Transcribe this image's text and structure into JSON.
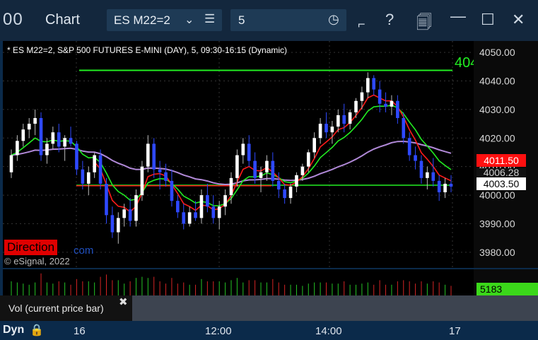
{
  "window": {
    "logo": "00",
    "title": "Chart"
  },
  "toolbar": {
    "symbol": "ES M22=2",
    "interval": "5",
    "icons": [
      "chevron-down-icon",
      "hamburger-menu-icon",
      "clock-icon",
      "draw-icon",
      "help-icon",
      "template-icon",
      "minimize-icon",
      "maximize-icon",
      "close-icon"
    ]
  },
  "chart": {
    "header": "* ES M22=2, S&P 500 FUTURES E-MINI (DAY), 5, 09:30-16:15 (Dynamic)",
    "direction_label": "Direction",
    "com_label": "com",
    "copyright": "© eSignal, 2022",
    "alert_label": "404",
    "price_red": "4011.50",
    "price_purple": "4006.28",
    "price_last": "4003.50",
    "volume_last": "5183",
    "volume_tooltip": "Vol (current price bar)",
    "dyn_label": "Dyn",
    "colors": {
      "up": "#ffffff",
      "down": "#2e49ff",
      "red": "#ff1a1a",
      "green": "#22ee22",
      "purple": "#b189d8",
      "vol_up": "#25c425",
      "vol_down": "#d42424"
    }
  },
  "chart_data": {
    "type": "candlestick",
    "y_ticks": [
      "4050.00",
      "4040.00",
      "4030.00",
      "4020.00",
      "4010.00",
      "4000.00",
      "3990.00",
      "3980.00"
    ],
    "ylim": [
      3977,
      4052
    ],
    "x_ticks": [
      "16",
      "12:00",
      "14:00",
      "17"
    ],
    "candles": [
      [
        4008,
        4016,
        4006,
        4014
      ],
      [
        4014,
        4021,
        4012,
        4019
      ],
      [
        4019,
        4025,
        4017,
        4023
      ],
      [
        4023,
        4027,
        4020,
        4025
      ],
      [
        4025,
        4030,
        4021,
        4027
      ],
      [
        4027,
        4029,
        4012,
        4014
      ],
      [
        4014,
        4020,
        4011,
        4018
      ],
      [
        4018,
        4024,
        4016,
        4022
      ],
      [
        4022,
        4025,
        4015,
        4017
      ],
      [
        4017,
        4021,
        4012,
        4020
      ],
      [
        4020,
        4024,
        4017,
        4018
      ],
      [
        4018,
        4019,
        4007,
        4009
      ],
      [
        4009,
        4012,
        4002,
        4004
      ],
      [
        4004,
        4010,
        4000,
        4008
      ],
      [
        4008,
        4015,
        4006,
        4014
      ],
      [
        4014,
        4016,
        4002,
        4004
      ],
      [
        4004,
        4006,
        3990,
        3993
      ],
      [
        3993,
        3996,
        3985,
        3987
      ],
      [
        3987,
        3994,
        3983,
        3992
      ],
      [
        3992,
        3997,
        3989,
        3995
      ],
      [
        3995,
        3999,
        3989,
        3991
      ],
      [
        3991,
        4002,
        3989,
        4000
      ],
      [
        4000,
        4012,
        3998,
        4010
      ],
      [
        4010,
        4021,
        4008,
        4018
      ],
      [
        4018,
        4020,
        4006,
        4009
      ],
      [
        4009,
        4012,
        4002,
        4008
      ],
      [
        4008,
        4011,
        4003,
        4005
      ],
      [
        4005,
        4009,
        3996,
        3998
      ],
      [
        3998,
        4000,
        3992,
        3994
      ],
      [
        3994,
        3997,
        3988,
        3990
      ],
      [
        3990,
        3996,
        3989,
        3994
      ],
      [
        3994,
        3998,
        3991,
        3992
      ],
      [
        3992,
        4002,
        3990,
        4000
      ],
      [
        4000,
        4004,
        3994,
        3996
      ],
      [
        3996,
        4000,
        3990,
        3992
      ],
      [
        3992,
        3998,
        3988,
        3996
      ],
      [
        3996,
        4002,
        3993,
        4000
      ],
      [
        4000,
        4008,
        3997,
        4006
      ],
      [
        4006,
        4016,
        4003,
        4014
      ],
      [
        4014,
        4020,
        4011,
        4018
      ],
      [
        4018,
        4021,
        4010,
        4012
      ],
      [
        4012,
        4015,
        4004,
        4006
      ],
      [
        4006,
        4010,
        4001,
        4008
      ],
      [
        4008,
        4014,
        4005,
        4012
      ],
      [
        4012,
        4015,
        4003,
        4005
      ],
      [
        4005,
        4008,
        3999,
        4002
      ],
      [
        4002,
        4004,
        3997,
        3999
      ],
      [
        3999,
        4004,
        3997,
        4003
      ],
      [
        4003,
        4008,
        4001,
        4007
      ],
      [
        4007,
        4011,
        4005,
        4010
      ],
      [
        4010,
        4016,
        4008,
        4015
      ],
      [
        4015,
        4022,
        4013,
        4020
      ],
      [
        4020,
        4027,
        4018,
        4025
      ],
      [
        4025,
        4029,
        4020,
        4022
      ],
      [
        4022,
        4026,
        4018,
        4024
      ],
      [
        4024,
        4030,
        4022,
        4028
      ],
      [
        4028,
        4032,
        4022,
        4025
      ],
      [
        4025,
        4030,
        4023,
        4029
      ],
      [
        4029,
        4034,
        4027,
        4033
      ],
      [
        4033,
        4038,
        4030,
        4036
      ],
      [
        4036,
        4043,
        4034,
        4041
      ],
      [
        4041,
        4042,
        4035,
        4037
      ],
      [
        4037,
        4040,
        4029,
        4032
      ],
      [
        4032,
        4036,
        4029,
        4031
      ],
      [
        4031,
        4035,
        4028,
        4033
      ],
      [
        4033,
        4035,
        4025,
        4027
      ],
      [
        4027,
        4029,
        4018,
        4020
      ],
      [
        4020,
        4022,
        4012,
        4014
      ],
      [
        4014,
        4017,
        4009,
        4012
      ],
      [
        4012,
        4014,
        4004,
        4006
      ],
      [
        4006,
        4010,
        4002,
        4008
      ],
      [
        4008,
        4013,
        4003,
        4005
      ],
      [
        4005,
        4007,
        3998,
        4001
      ],
      [
        4001,
        4006,
        3999,
        4004
      ],
      [
        4004,
        4007,
        4001,
        4003
      ]
    ]
  }
}
